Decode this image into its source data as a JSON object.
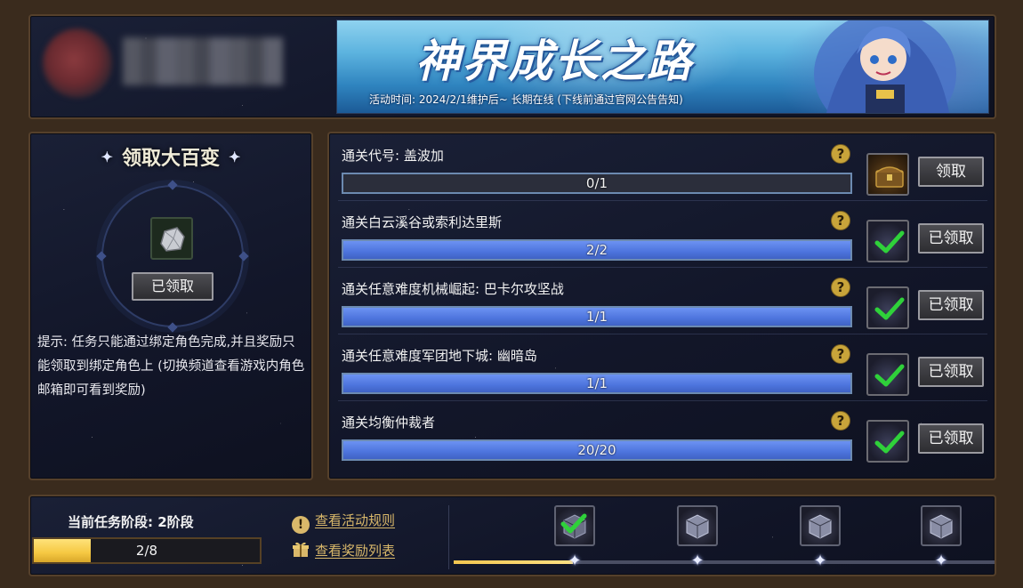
{
  "header": {
    "banner_title": "神界成长之路",
    "banner_time": "活动时间: 2024/2/1维护后~ 长期在线 (下线前通过官网公告告知)"
  },
  "left_panel": {
    "title": "领取大百变",
    "claimed_label": "已领取",
    "tip": "提示: 任务只能通过绑定角色完成,并且奖励只能领取到绑定角色上 (切换频道查看游戏内角色邮箱即可看到奖励)"
  },
  "tasks": [
    {
      "name": "通关代号: 盖波加",
      "progress_text": "0/1",
      "progress": 0,
      "button": "领取",
      "claimed": false
    },
    {
      "name": "通关白云溪谷或索利达里斯",
      "progress_text": "2/2",
      "progress": 1,
      "button": "已领取",
      "claimed": true
    },
    {
      "name": "通关任意难度机械崛起: 巴卡尔攻坚战",
      "progress_text": "1/1",
      "progress": 1,
      "button": "已领取",
      "claimed": true
    },
    {
      "name": "通关任意难度军团地下城: 幽暗岛",
      "progress_text": "1/1",
      "progress": 1,
      "button": "已领取",
      "claimed": true
    },
    {
      "name": "通关均衡仲裁者",
      "progress_text": "20/20",
      "progress": 1,
      "button": "已领取",
      "claimed": true
    }
  ],
  "bottom": {
    "stage_label": "当前任务阶段: 2阶段",
    "stage_progress_text": "2/8",
    "stage_progress": 0.25,
    "link_rules": "查看活动规则",
    "link_rewards": "查看奖励列表",
    "milestone_progress": 0.22,
    "milestones": [
      {
        "claimed": true
      },
      {
        "claimed": false
      },
      {
        "claimed": false
      },
      {
        "claimed": false
      }
    ]
  },
  "colors": {
    "accent_blue": "#4d74dd",
    "stage_gold": "#f5c842",
    "link_gold": "#d9b86a",
    "check_green": "#2fd13a"
  },
  "icons": {
    "help": "question-mark-icon",
    "check": "checkmark-icon",
    "rules_link": "exclamation-circle-icon",
    "rewards_link": "gift-icon"
  }
}
